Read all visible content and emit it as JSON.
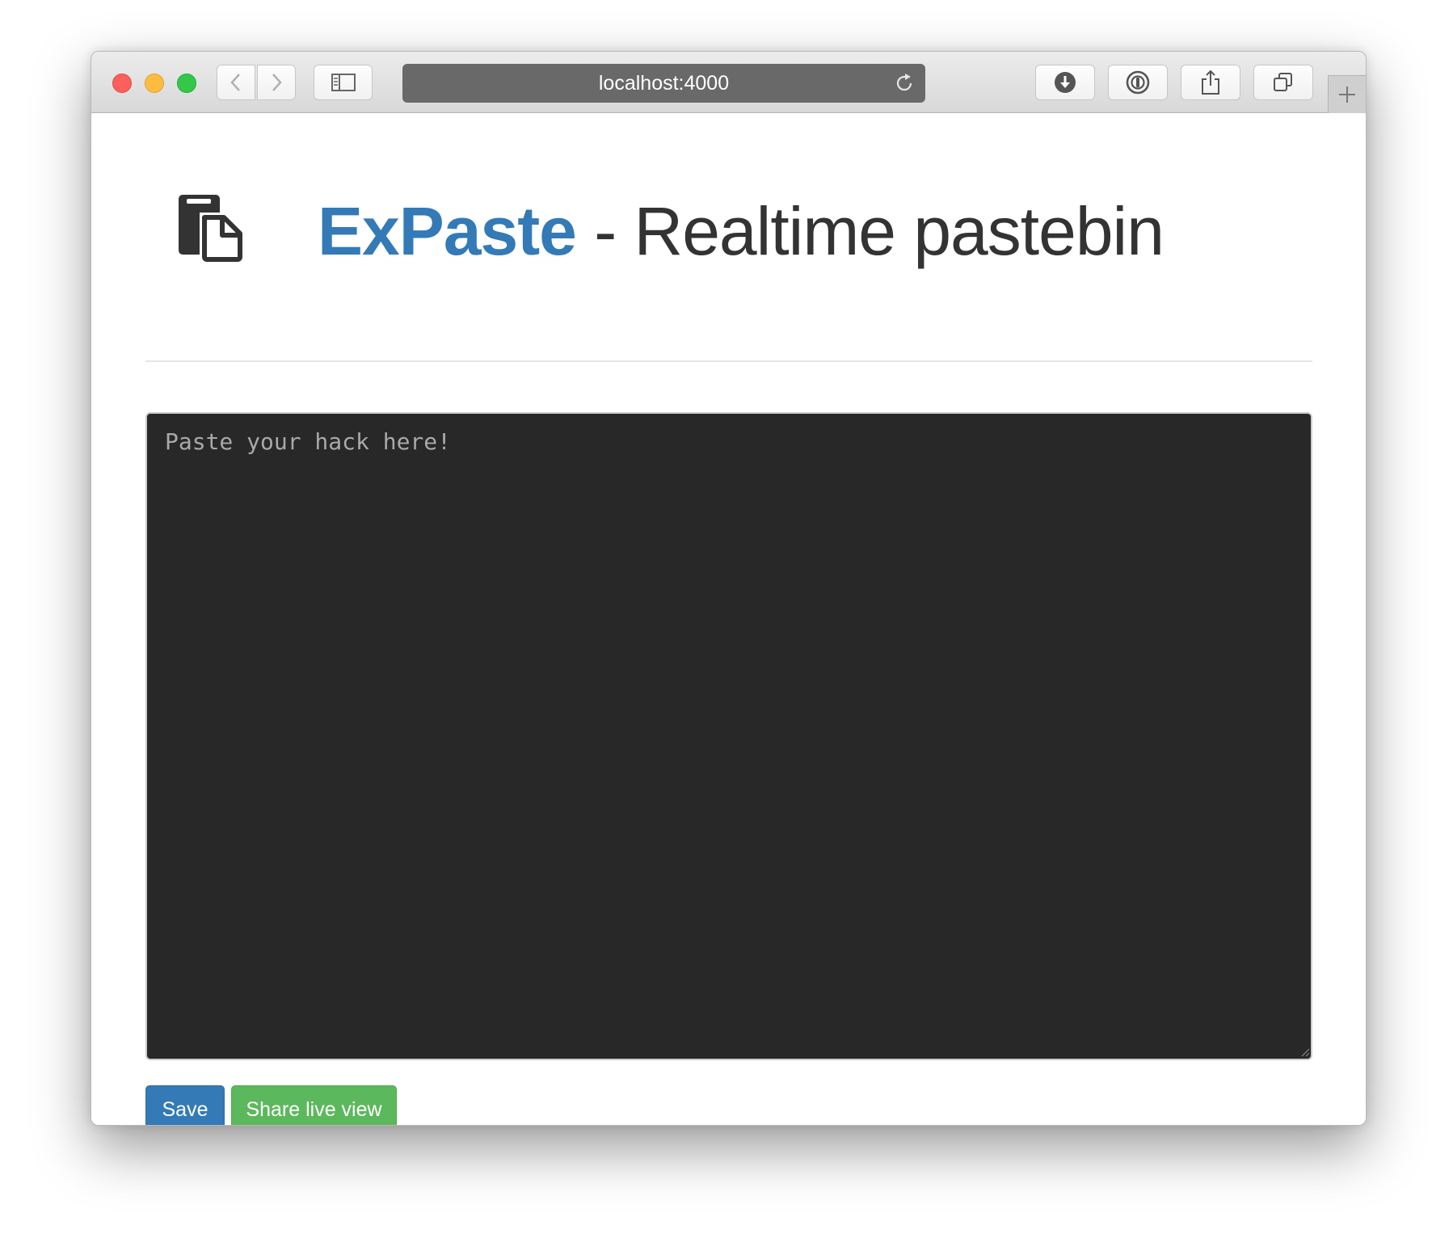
{
  "browser": {
    "url": "localhost:4000",
    "toolbar_icons": [
      "back-icon",
      "forward-icon",
      "sidebar-icon",
      "reload-icon",
      "download-icon",
      "password-manager-icon",
      "share-icon",
      "tabs-icon",
      "new-tab-icon"
    ]
  },
  "header": {
    "logo_icon": "paste-icon",
    "brand": "ExPaste",
    "subtitle": " - Realtime pastebin"
  },
  "editor": {
    "placeholder": "Paste your hack here!",
    "value": ""
  },
  "actions": {
    "save_label": "Save",
    "share_label": "Share live view"
  },
  "colors": {
    "brand": "#337ab7",
    "save": "#337ab7",
    "share": "#5cb85c",
    "editor_bg": "#282828"
  }
}
